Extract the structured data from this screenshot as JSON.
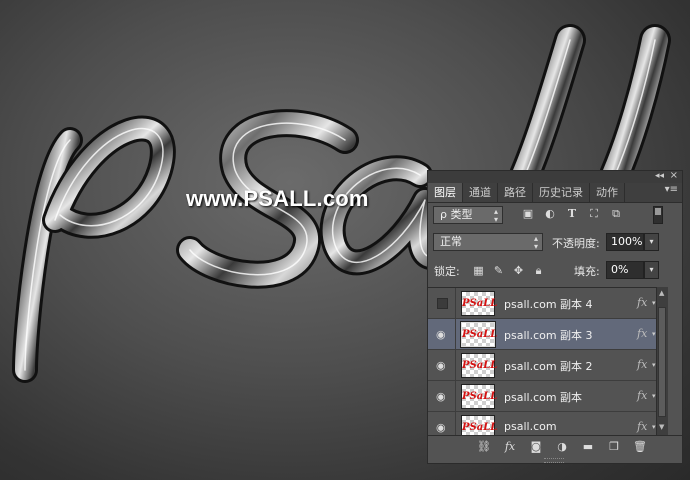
{
  "canvas": {
    "artwork_text": "psall",
    "watermark": "www.PSALL.com"
  },
  "panel": {
    "tabs": [
      {
        "label": "图层",
        "active": true
      },
      {
        "label": "通道",
        "active": false
      },
      {
        "label": "路径",
        "active": false
      },
      {
        "label": "历史记录",
        "active": false
      },
      {
        "label": "动作",
        "active": false
      }
    ],
    "filter": {
      "label": "ρ 类型"
    },
    "blend_mode": "正常",
    "opacity_label": "不透明度:",
    "opacity_value": "100%",
    "lock_label": "锁定:",
    "fill_label": "填充:",
    "fill_value": "0%",
    "layers": [
      {
        "name": "psall.com 副本 4",
        "visible": false,
        "selected": false,
        "fx": "fx"
      },
      {
        "name": "psall.com 副本 3",
        "visible": true,
        "selected": true,
        "fx": "fx"
      },
      {
        "name": "psall.com 副本 2",
        "visible": true,
        "selected": false,
        "fx": "fx"
      },
      {
        "name": "psall.com 副本",
        "visible": true,
        "selected": false,
        "fx": "fx"
      },
      {
        "name": "psall.com",
        "visible": true,
        "selected": false,
        "fx": "fx"
      }
    ],
    "thumb_text": "PSaLL",
    "colors": {
      "selected_row": "#62697a",
      "panel_bg": "#535353",
      "thumb_text": "#d41111"
    },
    "icons": [
      "link-icon",
      "fx-icon",
      "mask-icon",
      "adjustment-icon",
      "group-folder-icon",
      "new-layer-icon",
      "trash-icon"
    ]
  }
}
